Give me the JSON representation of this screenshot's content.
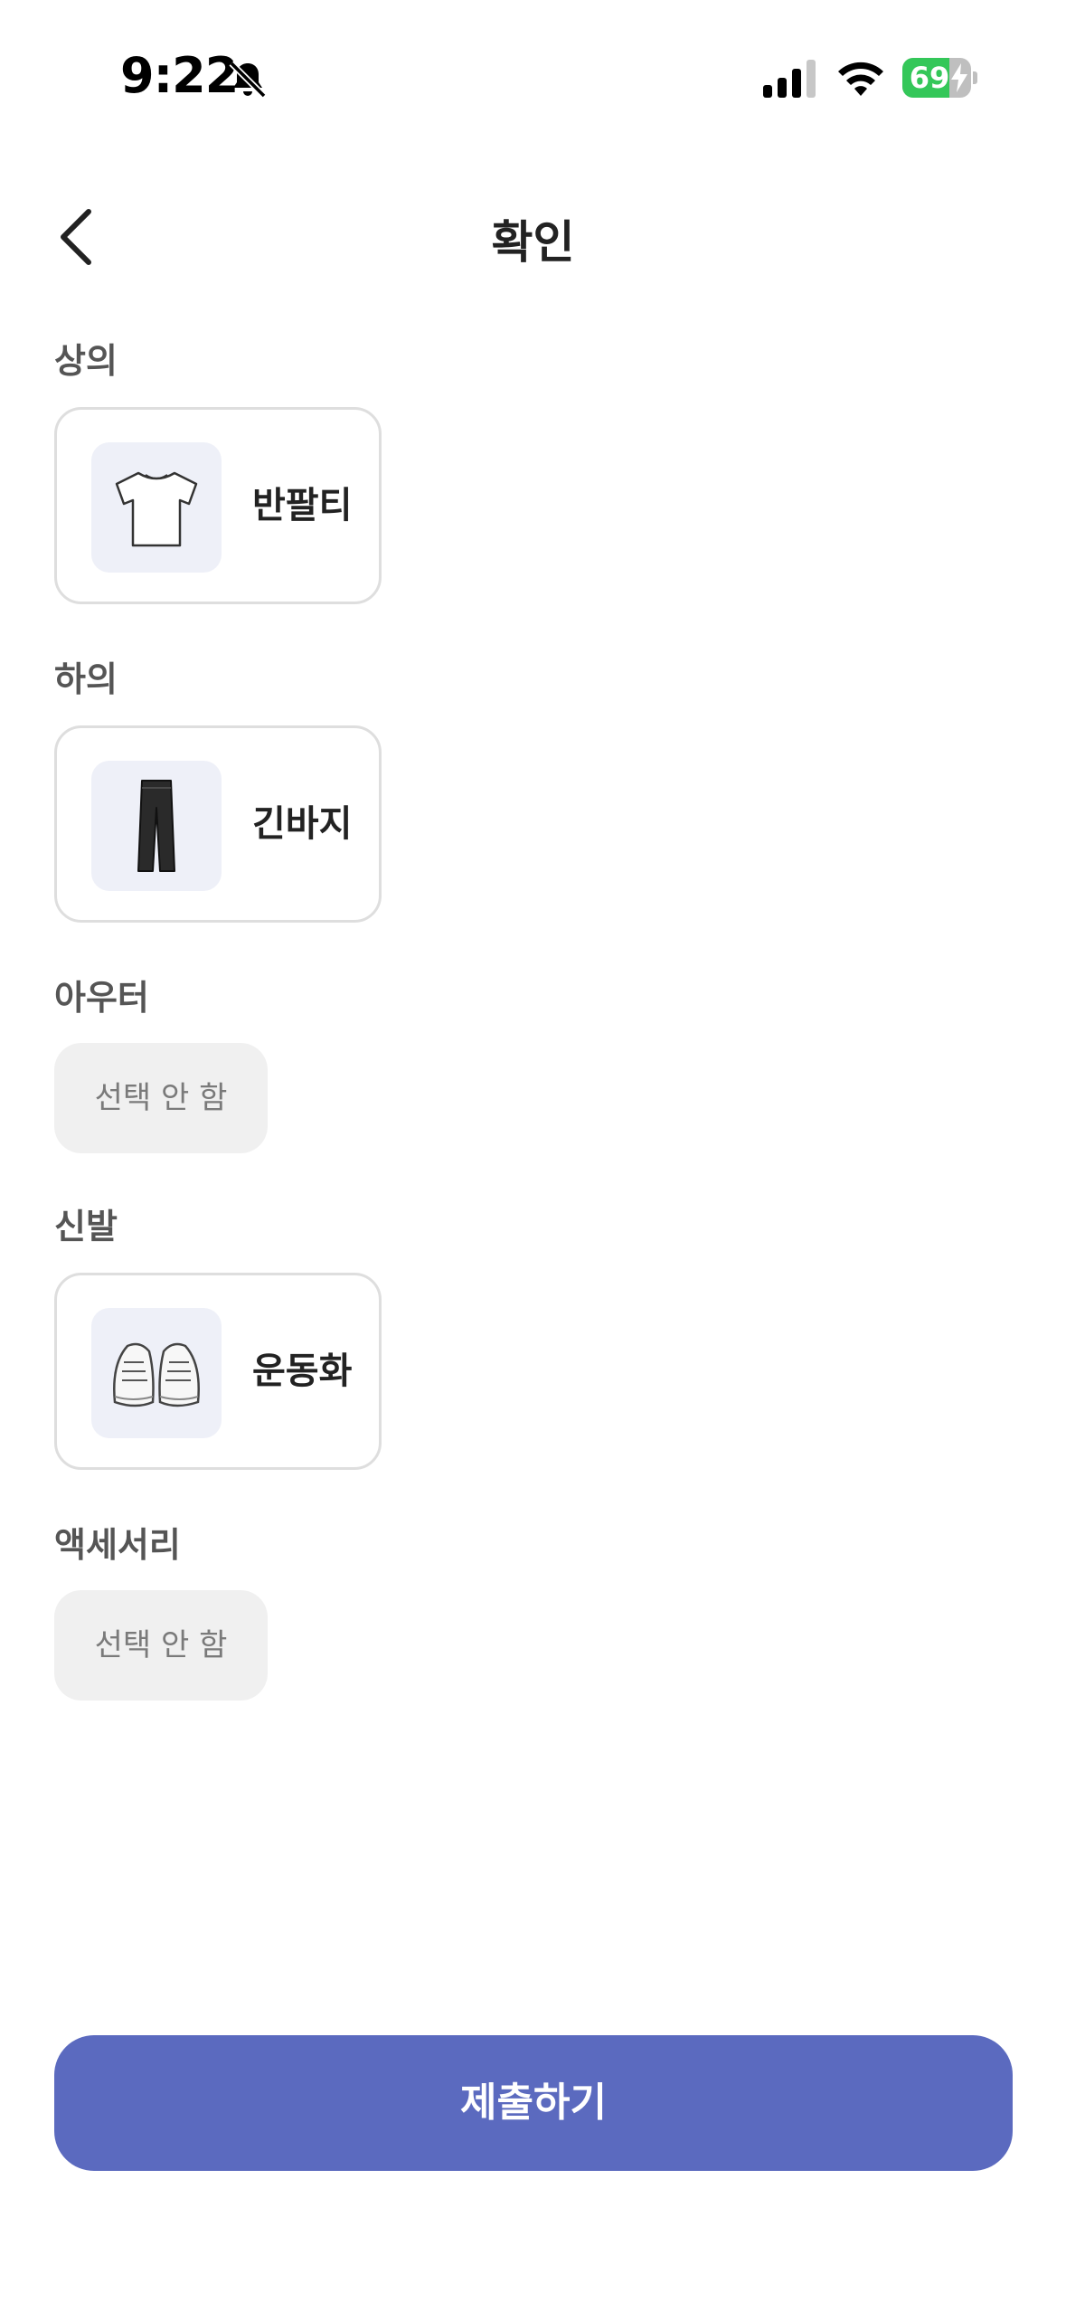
{
  "status_bar": {
    "time": "9:22",
    "battery_percent": "69",
    "battery_level": 0.69,
    "icons": [
      "bell-slash-icon",
      "cellular-signal-icon",
      "wifi-icon",
      "battery-charging-icon"
    ]
  },
  "header": {
    "back_icon": "chevron-left-icon",
    "title": "확인"
  },
  "sections": {
    "top": {
      "label": "상의",
      "item_name": "반팔티",
      "item_icon": "tshirt-icon"
    },
    "bottom": {
      "label": "하의",
      "item_name": "긴바지",
      "item_icon": "pants-icon"
    },
    "outer": {
      "label": "아우터",
      "empty_text": "선택 안 함"
    },
    "shoes": {
      "label": "신발",
      "item_name": "운동화",
      "item_icon": "sneakers-icon"
    },
    "accessory": {
      "label": "액세서리",
      "empty_text": "선택 안 함"
    }
  },
  "footer": {
    "submit_label": "제출하기"
  },
  "colors": {
    "primary": "#5b6abf",
    "battery_green": "#34c759",
    "thumb_bg": "#eef0f8",
    "chip_bg": "#f0f0f0",
    "card_border": "#dedede"
  }
}
